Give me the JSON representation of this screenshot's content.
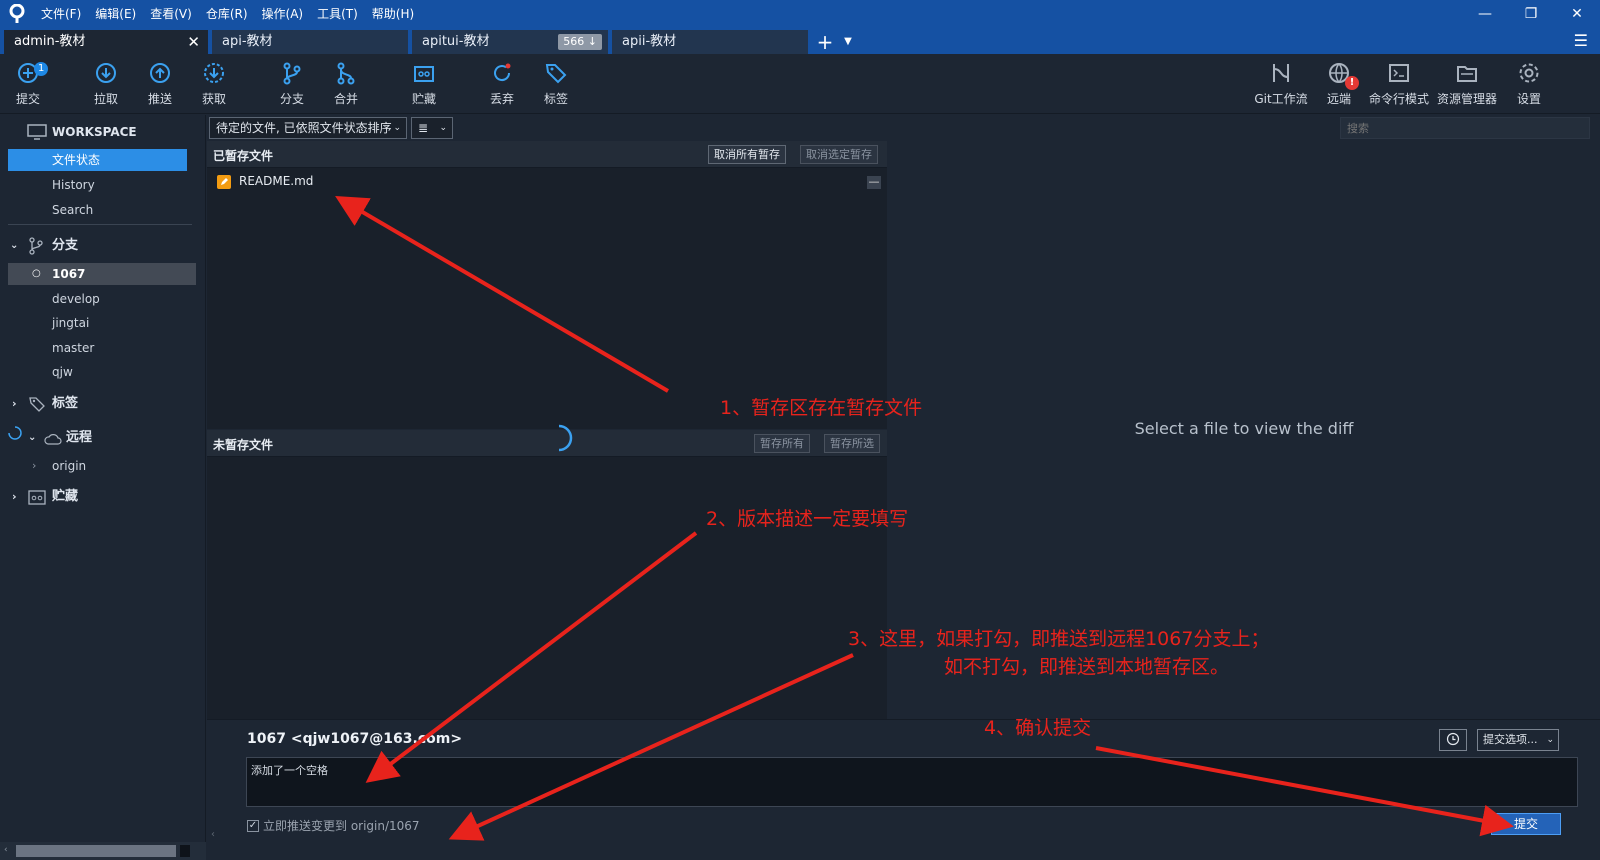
{
  "menu": [
    "文件(F)",
    "编辑(E)",
    "查看(V)",
    "仓库(R)",
    "操作(A)",
    "工具(T)",
    "帮助(H)"
  ],
  "tabs": [
    {
      "label": "admin-教材"
    },
    {
      "label": "api-教材"
    },
    {
      "label": "apitui-教材",
      "badge": "566 ↓"
    },
    {
      "label": "apii-教材"
    }
  ],
  "toolbar": {
    "commit": "提交",
    "commit_badge": "1",
    "pull": "拉取",
    "push": "推送",
    "fetch": "获取",
    "branch": "分支",
    "merge": "合并",
    "stash": "贮藏",
    "discard": "丢弃",
    "tag": "标签",
    "gitflow": "Git工作流",
    "remote": "远端",
    "terminal": "命令行模式",
    "explorer": "资源管理器",
    "settings": "设置"
  },
  "sidebar": {
    "workspace": "WORKSPACE",
    "file_status": "文件状态",
    "history": "History",
    "search": "Search",
    "branches_head": "分支",
    "branches": [
      "1067",
      "develop",
      "jingtai",
      "master",
      "qjw"
    ],
    "tags_head": "标签",
    "remotes_head": "远程",
    "remotes": [
      "origin"
    ],
    "stash_head": "贮藏"
  },
  "filter": {
    "sort_label": "待定的文件, 已依照文件状态排序",
    "view_label": "≣",
    "search_placeholder": "搜索"
  },
  "staged": {
    "title": "已暂存文件",
    "unstage_all": "取消所有暂存",
    "unstage_selected": "取消选定暂存",
    "files": [
      "README.md"
    ]
  },
  "unstaged": {
    "title": "未暂存文件",
    "stage_all": "暂存所有",
    "stage_selected": "暂存所选"
  },
  "diff": {
    "placeholder": "Select a file to view the diff"
  },
  "commit": {
    "author": "1067 <qjw1067@163.com>",
    "message": "添加了一个空格",
    "push_label": "立即推送变更到 origin/1067",
    "options_label": "提交选项...",
    "commit_button": "提交"
  },
  "annotations": {
    "a1": "1、暂存区存在暂存文件",
    "a2": "2、版本描述一定要填写",
    "a3_line1": "3、这里，如果打勾，即推送到远程1067分支上；",
    "a3_line2": "如不打勾，即推送到本地暂存区。",
    "a4": "4、确认提交"
  },
  "colors": {
    "accent": "#1551a3",
    "selection": "#2c8ee6",
    "annotation": "#e8231c",
    "file_modified": "#f39c12"
  }
}
